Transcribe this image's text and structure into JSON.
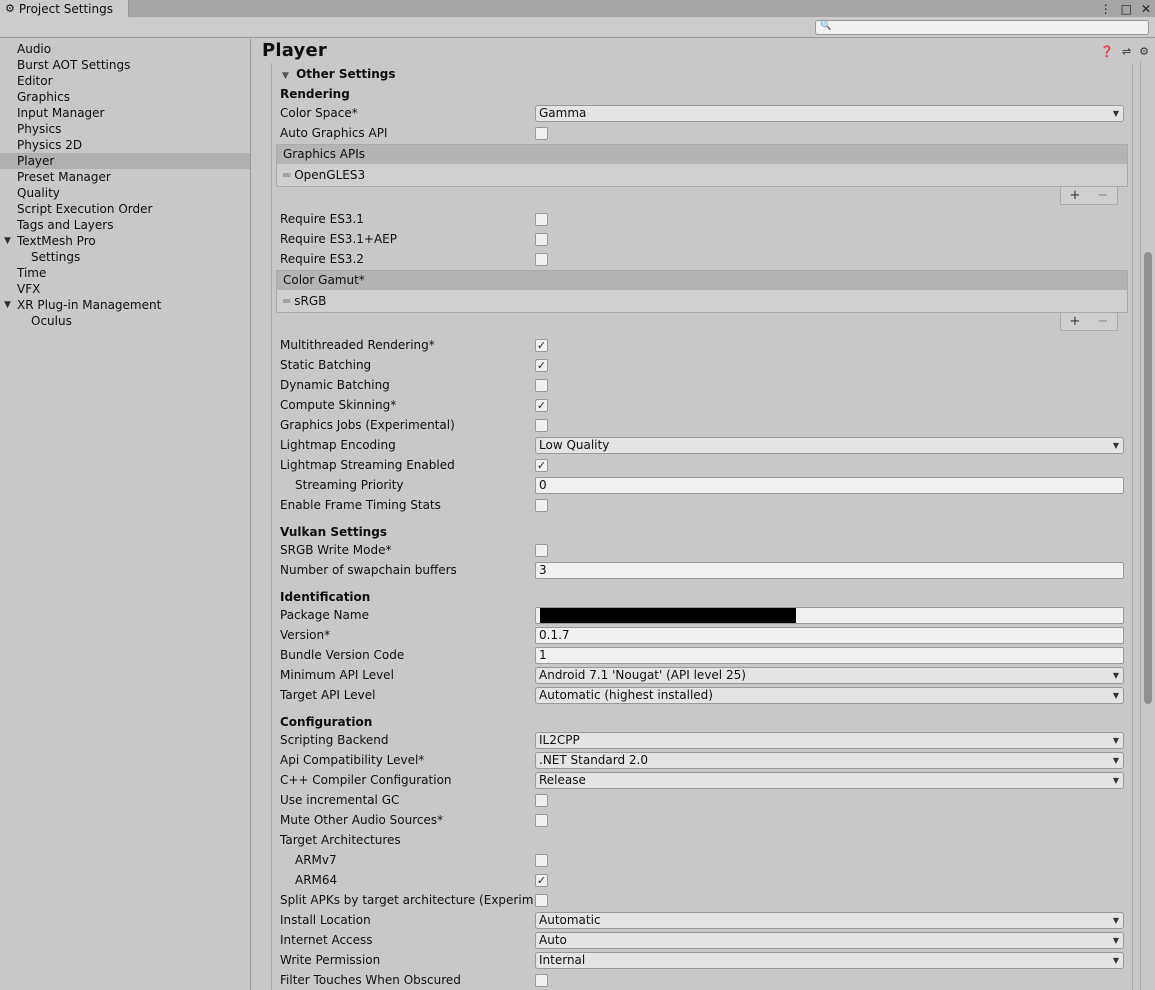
{
  "window": {
    "tab_title": "Project Settings"
  },
  "search": {
    "placeholder": ""
  },
  "sidebar": {
    "items": [
      {
        "label": "Audio"
      },
      {
        "label": "Burst AOT Settings"
      },
      {
        "label": "Editor"
      },
      {
        "label": "Graphics"
      },
      {
        "label": "Input Manager"
      },
      {
        "label": "Physics"
      },
      {
        "label": "Physics 2D"
      },
      {
        "label": "Player",
        "selected": true
      },
      {
        "label": "Preset Manager"
      },
      {
        "label": "Quality"
      },
      {
        "label": "Script Execution Order"
      },
      {
        "label": "Tags and Layers"
      },
      {
        "label": "TextMesh Pro",
        "expanded": true
      },
      {
        "label": "Settings",
        "child": true
      },
      {
        "label": "Time"
      },
      {
        "label": "VFX"
      },
      {
        "label": "XR Plug-in Management",
        "expanded": true
      },
      {
        "label": "Oculus",
        "child": true
      }
    ]
  },
  "main": {
    "title": "Player",
    "section": "Other Settings",
    "rendering": {
      "header": "Rendering",
      "color_space_label": "Color Space*",
      "color_space_value": "Gamma",
      "auto_graphics_api_label": "Auto Graphics API",
      "auto_graphics_api_checked": false,
      "graphics_apis_header": "Graphics APIs",
      "graphics_apis_item": "OpenGLES3",
      "require_es31_label": "Require ES3.1",
      "require_es31aep_label": "Require ES3.1+AEP",
      "require_es32_label": "Require ES3.2",
      "color_gamut_header": "Color Gamut*",
      "color_gamut_item": "sRGB",
      "multithreaded_label": "Multithreaded Rendering*",
      "static_batching_label": "Static Batching",
      "dynamic_batching_label": "Dynamic Batching",
      "compute_skinning_label": "Compute Skinning*",
      "graphics_jobs_label": "Graphics Jobs (Experimental)",
      "lightmap_encoding_label": "Lightmap Encoding",
      "lightmap_encoding_value": "Low Quality",
      "lightmap_streaming_label": "Lightmap Streaming Enabled",
      "streaming_priority_label": "Streaming Priority",
      "streaming_priority_value": "0",
      "frame_timing_label": "Enable Frame Timing Stats"
    },
    "vulkan": {
      "header": "Vulkan Settings",
      "srgb_write_label": "SRGB Write Mode*",
      "swapchain_label": "Number of swapchain buffers",
      "swapchain_value": "3"
    },
    "identification": {
      "header": "Identification",
      "package_name_label": "Package Name",
      "version_label": "Version*",
      "version_value": "0.1.7",
      "bundle_code_label": "Bundle Version Code",
      "bundle_code_value": "1",
      "min_api_label": "Minimum API Level",
      "min_api_value": "Android 7.1 'Nougat' (API level 25)",
      "target_api_label": "Target API Level",
      "target_api_value": "Automatic (highest installed)"
    },
    "configuration": {
      "header": "Configuration",
      "scripting_backend_label": "Scripting Backend",
      "scripting_backend_value": "IL2CPP",
      "api_compat_label": "Api Compatibility Level*",
      "api_compat_value": ".NET Standard 2.0",
      "cpp_config_label": "C++ Compiler Configuration",
      "cpp_config_value": "Release",
      "incremental_gc_label": "Use incremental GC",
      "mute_audio_label": "Mute Other Audio Sources*",
      "target_arch_label": "Target Architectures",
      "armv7_label": "ARMv7",
      "arm64_label": "ARM64",
      "split_apks_label": "Split APKs by target architecture (Experimental)",
      "install_location_label": "Install Location",
      "install_location_value": "Automatic",
      "internet_access_label": "Internet Access",
      "internet_access_value": "Auto",
      "write_permission_label": "Write Permission",
      "write_permission_value": "Internal",
      "filter_touches_label": "Filter Touches When Obscured"
    },
    "glyphs": {
      "check": "✓",
      "plus": "+",
      "minus": "−",
      "handle": "═",
      "caret": "▼"
    }
  }
}
